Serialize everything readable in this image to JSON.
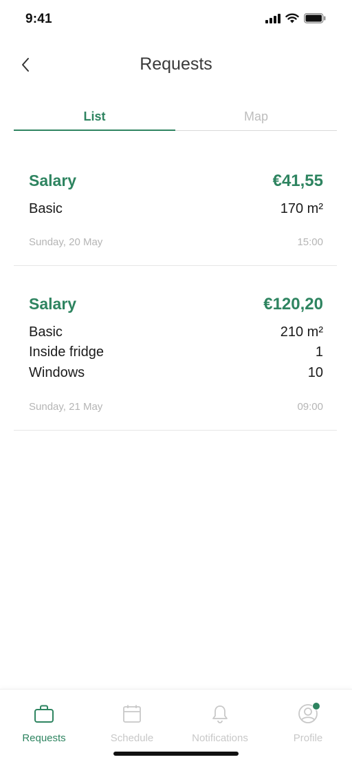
{
  "status_bar": {
    "time": "9:41"
  },
  "header": {
    "title": "Requests"
  },
  "tabs": [
    {
      "label": "List",
      "active": true
    },
    {
      "label": "Map",
      "active": false
    }
  ],
  "requests": [
    {
      "title": "Salary",
      "amount": "€41,55",
      "items": [
        {
          "label": "Basic",
          "value": "170 m²"
        }
      ],
      "date": "Sunday, 20 May",
      "time": "15:00"
    },
    {
      "title": "Salary",
      "amount": "€120,20",
      "items": [
        {
          "label": "Basic",
          "value": "210 m²"
        },
        {
          "label": "Inside fridge",
          "value": "1"
        },
        {
          "label": "Windows",
          "value": "10"
        }
      ],
      "date": "Sunday, 21 May",
      "time": "09:00"
    }
  ],
  "bottom_nav": [
    {
      "label": "Requests",
      "icon": "briefcase-icon",
      "active": true
    },
    {
      "label": "Schedule",
      "icon": "calendar-icon",
      "active": false
    },
    {
      "label": "Notifications",
      "icon": "bell-icon",
      "active": false
    },
    {
      "label": "Profile",
      "icon": "user-avatar-icon",
      "active": false,
      "badge": true
    }
  ],
  "colors": {
    "accent": "#2e8460",
    "muted": "#c8c8c8",
    "divider": "#e6e6e6"
  }
}
